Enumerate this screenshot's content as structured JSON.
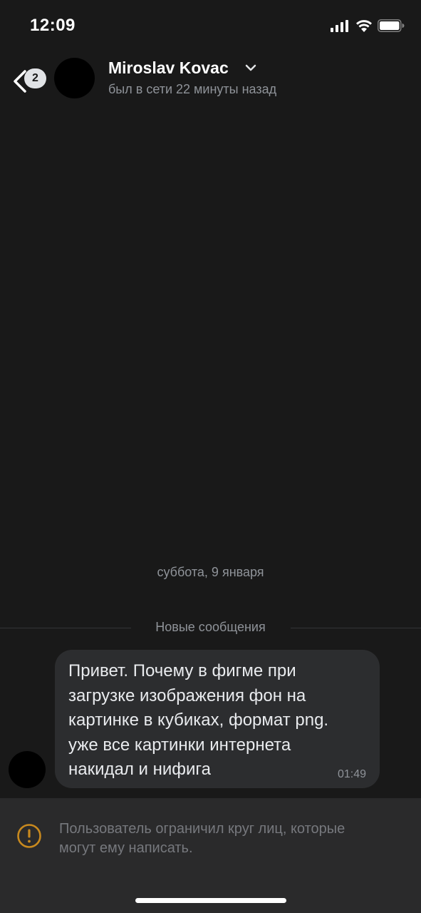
{
  "status_bar": {
    "time": "12:09",
    "icons": [
      "cellular-signal-icon",
      "wifi-icon",
      "battery-icon"
    ]
  },
  "header": {
    "back_badge": "2",
    "contact_name": "Miroslav Kovac",
    "last_seen": "был в сети 22 минуты назад"
  },
  "chat": {
    "date_separator": "суббота, 9 января",
    "new_messages_label": "Новые сообщения",
    "message": {
      "lines": [
        "Привет. Почему в фигме при",
        "загрузке изображения фон на",
        "картинке в кубиках, формат png.",
        "уже все картинки интернета",
        "накидал и нифига"
      ],
      "time": "01:49"
    }
  },
  "restriction": {
    "lines": [
      "Пользователь ограничил круг лиц, которые",
      "могут ему написать."
    ]
  },
  "colors": {
    "background": "#191919",
    "bubble": "#2c2d2f",
    "restriction_bar": "#2a2a2b",
    "warning_accent": "#c8891e",
    "secondary_text": "#8f9399"
  }
}
